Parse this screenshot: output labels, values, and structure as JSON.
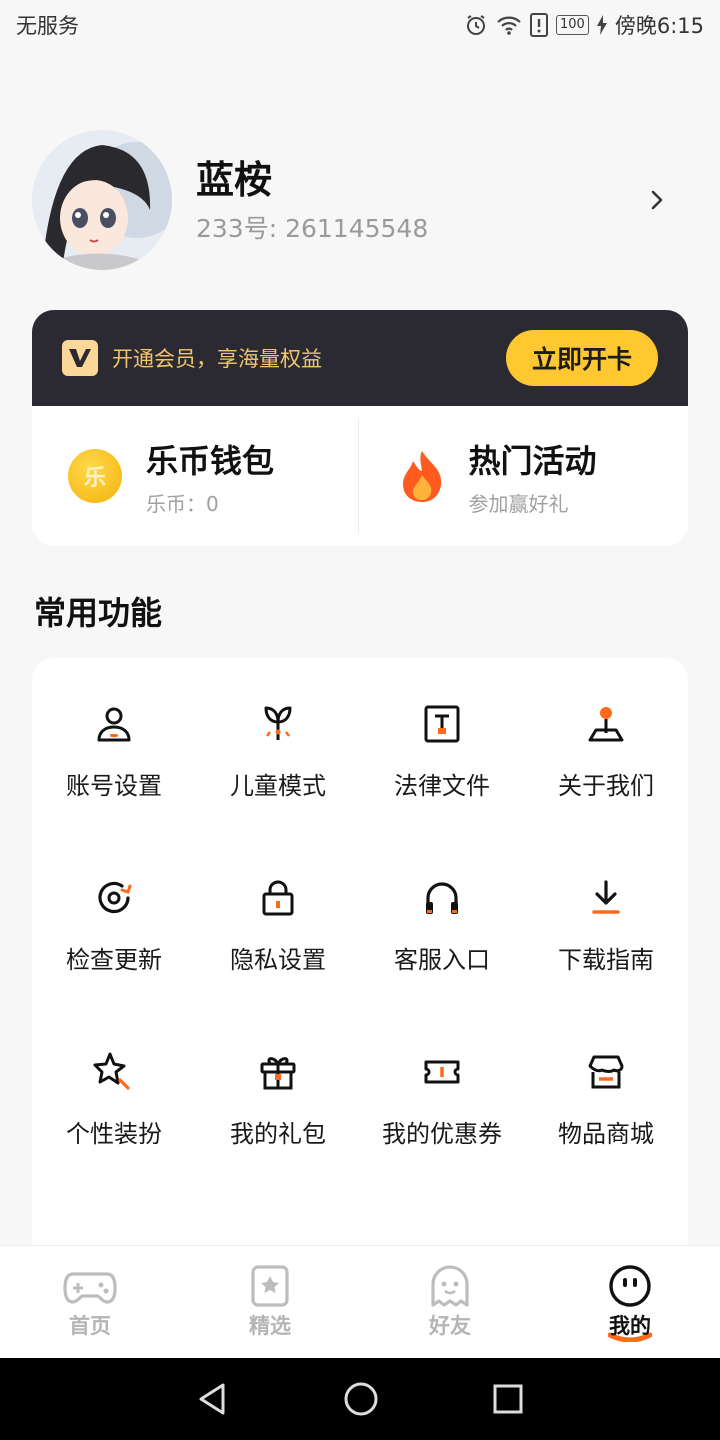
{
  "status_bar": {
    "carrier": "无服务",
    "battery": "100",
    "time": "傍晚6:15"
  },
  "profile": {
    "name": "蓝桉",
    "id_text": "233号: 261145548"
  },
  "vip": {
    "promo_text": "开通会员，享海量权益",
    "button_label": "立即开卡",
    "wallet": {
      "title": "乐币钱包",
      "coin_label": "乐币：0",
      "coin_glyph": "乐"
    },
    "activity": {
      "title": "热门活动",
      "subtitle": "参加赢好礼"
    }
  },
  "functions": {
    "title": "常用功能",
    "items": [
      {
        "label": "账号设置",
        "icon": "user-icon"
      },
      {
        "label": "儿童模式",
        "icon": "sprout-icon"
      },
      {
        "label": "法律文件",
        "icon": "document-icon"
      },
      {
        "label": "关于我们",
        "icon": "joystick-icon"
      },
      {
        "label": "检查更新",
        "icon": "refresh-icon"
      },
      {
        "label": "隐私设置",
        "icon": "lock-icon"
      },
      {
        "label": "客服入口",
        "icon": "headphones-icon"
      },
      {
        "label": "下载指南",
        "icon": "download-icon"
      },
      {
        "label": "个性装扮",
        "icon": "magic-star-icon"
      },
      {
        "label": "我的礼包",
        "icon": "gift-icon"
      },
      {
        "label": "我的优惠券",
        "icon": "ticket-icon"
      },
      {
        "label": "物品商城",
        "icon": "shop-icon"
      }
    ]
  },
  "tabs": [
    {
      "label": "首页",
      "icon": "gamepad-icon",
      "active": false
    },
    {
      "label": "精选",
      "icon": "featured-star-icon",
      "active": false
    },
    {
      "label": "好友",
      "icon": "ghost-icon",
      "active": false
    },
    {
      "label": "我的",
      "icon": "face-icon",
      "active": true
    }
  ],
  "colors": {
    "accent": "#ff6a1a",
    "vip_bg": "#2b2a33",
    "vip_button": "#ffc830",
    "vip_text": "#f3c46d"
  }
}
